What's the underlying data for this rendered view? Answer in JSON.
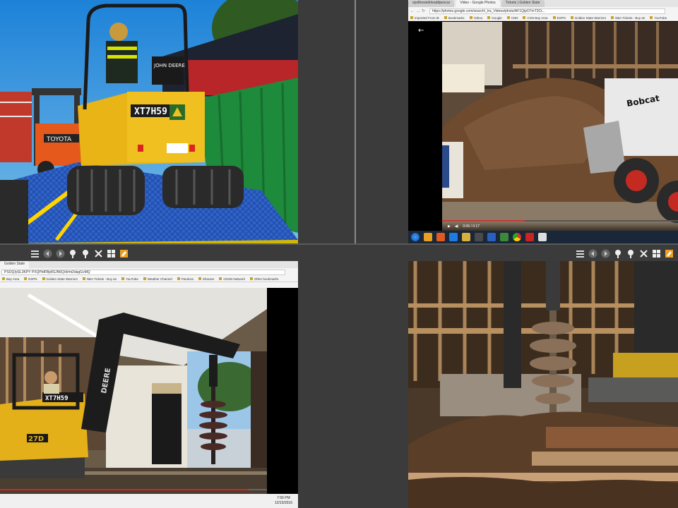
{
  "viewer": {
    "toolbar_icons": [
      "prev-icon",
      "next-icon",
      "zoom-in-icon",
      "zoom-out-icon",
      "close-icon",
      "grid-icon",
      "edit-icon"
    ]
  },
  "top_left": {
    "plate_text": "XT7H59",
    "brand_text": "JOHN DEERE",
    "forklift_text": "TOYOTA"
  },
  "top_right": {
    "tabs": [
      "ejodhesiedrteaddpescar",
      "Video - Google Photos",
      "Tickets | Golden State"
    ],
    "url": "https://photos.google.com/search/_tra_Videos/photo/AF1QipO7mT3Ct...",
    "bookmarks": [
      "Imported From IE",
      "Bookmarks",
      "Yahoo",
      "Google",
      "CNN",
      "CSN Bay Area",
      "ESPN",
      "Golden State Warriors",
      "NBA Tickets - Buy an",
      "YouTube"
    ],
    "skid_steer_brand": "Bobcat",
    "video_time": "0:06 / 0:17",
    "video_progress": 0.35
  },
  "bottom_left": {
    "tab": "Golden State",
    "url": "PSOQ/pSL3KPY PXQPtdFBp8SJN6Q/d/mt2dagGvMQ",
    "bookmarks": [
      "Bay Area",
      "ESPN",
      "Golden State Warriors",
      "NBA Tickets - Buy an",
      "YouTube",
      "Weather Channel",
      "Pandora",
      "Shazam",
      "OSSN Network",
      "Other bookmarks"
    ],
    "excavator_brand": "DEERE",
    "excavator_model": "27D",
    "plate_text": "XT7H59",
    "clock_time": "7:56 PM",
    "clock_date": "12/15/2016",
    "video_progress": 0.93
  }
}
